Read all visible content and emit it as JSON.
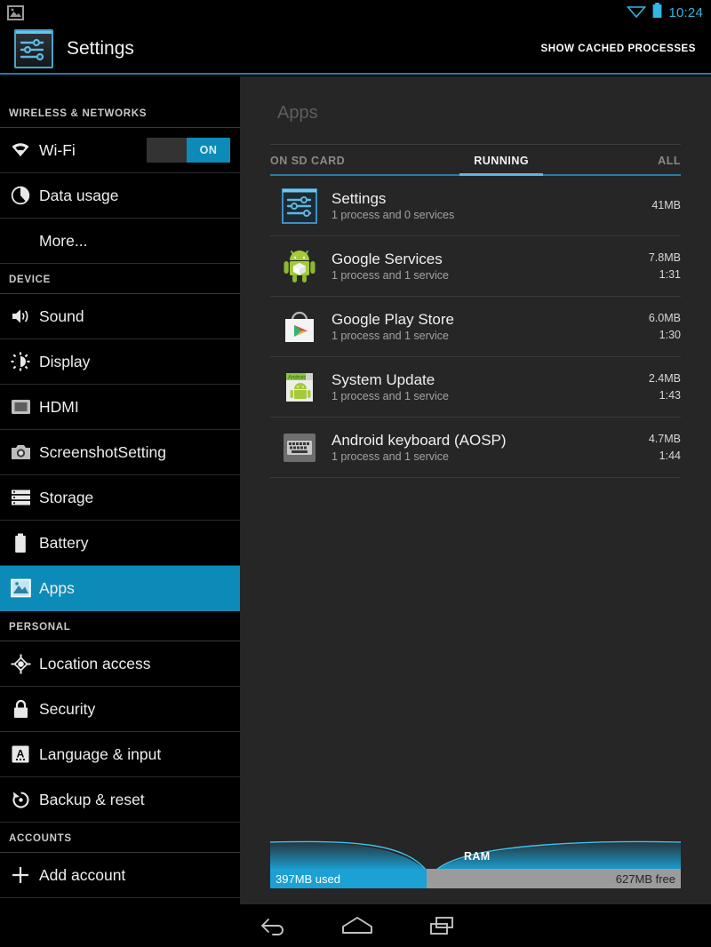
{
  "statusbar": {
    "notification_icon": "image-icon",
    "wifi_icon": "wifi-no-signal-icon",
    "battery_icon": "battery-full-icon",
    "clock": "10:24"
  },
  "actionbar": {
    "app_icon": "settings-sliders-icon",
    "title": "Settings",
    "action_label": "SHOW CACHED PROCESSES"
  },
  "sidebar": {
    "sections": [
      {
        "header": "WIRELESS & NETWORKS",
        "items": [
          {
            "label": "Wi-Fi",
            "icon": "wifi-icon",
            "toggle": "ON",
            "selected": false
          },
          {
            "label": "Data usage",
            "icon": "pie-chart-icon",
            "selected": false
          },
          {
            "label": "More...",
            "icon": null,
            "selected": false
          }
        ]
      },
      {
        "header": "DEVICE",
        "items": [
          {
            "label": "Sound",
            "icon": "speaker-icon",
            "selected": false
          },
          {
            "label": "Display",
            "icon": "brightness-icon",
            "selected": false
          },
          {
            "label": "HDMI",
            "icon": "monitor-icon",
            "selected": false
          },
          {
            "label": "ScreenshotSetting",
            "icon": "camera-icon",
            "selected": false
          },
          {
            "label": "Storage",
            "icon": "storage-stack-icon",
            "selected": false
          },
          {
            "label": "Battery",
            "icon": "battery-icon",
            "selected": false
          },
          {
            "label": "Apps",
            "icon": "apps-icon",
            "selected": true
          }
        ]
      },
      {
        "header": "PERSONAL",
        "items": [
          {
            "label": "Location access",
            "icon": "location-crosshair-icon",
            "selected": false
          },
          {
            "label": "Security",
            "icon": "lock-icon",
            "selected": false
          },
          {
            "label": "Language & input",
            "icon": "language-a-icon",
            "selected": false
          },
          {
            "label": "Backup & reset",
            "icon": "restore-icon",
            "selected": false
          }
        ]
      },
      {
        "header": "ACCOUNTS",
        "items": [
          {
            "label": "Add account",
            "icon": "plus-icon",
            "selected": false
          }
        ]
      }
    ]
  },
  "main": {
    "title": "Apps",
    "tabs": [
      {
        "label": "ON SD CARD",
        "selected": false
      },
      {
        "label": "RUNNING",
        "selected": true
      },
      {
        "label": "ALL",
        "selected": false
      }
    ],
    "apps": [
      {
        "icon": "settings-sliders-icon",
        "name": "Settings",
        "subtitle": "1 process and 0 services",
        "size": "41MB",
        "time": ""
      },
      {
        "icon": "android-services-icon",
        "name": "Google Services",
        "subtitle": "1 process and 1 service",
        "size": "7.8MB",
        "time": "1:31"
      },
      {
        "icon": "play-store-icon",
        "name": "Google Play Store",
        "subtitle": "1 process and 1 service",
        "size": "6.0MB",
        "time": "1:30"
      },
      {
        "icon": "system-update-icon",
        "name": "System Update",
        "subtitle": "1 process and 1 service",
        "size": "2.4MB",
        "time": "1:43"
      },
      {
        "icon": "keyboard-icon",
        "name": "Android keyboard (AOSP)",
        "subtitle": "1 process and 1 service",
        "size": "4.7MB",
        "time": "1:44"
      }
    ],
    "ram": {
      "label": "RAM",
      "used_label": "397MB used",
      "free_label": "627MB free",
      "used_percent": 38,
      "used_color": "#1ba1d4",
      "free_color": "#9b9b9b"
    }
  },
  "navbar": {
    "back": "back-icon",
    "home": "home-icon",
    "recents": "recents-icon"
  },
  "colors": {
    "accent": "#0d8bb8",
    "accent_light": "#5ab9de",
    "sidebar_bg": "#000000",
    "main_bg": "#262626"
  }
}
